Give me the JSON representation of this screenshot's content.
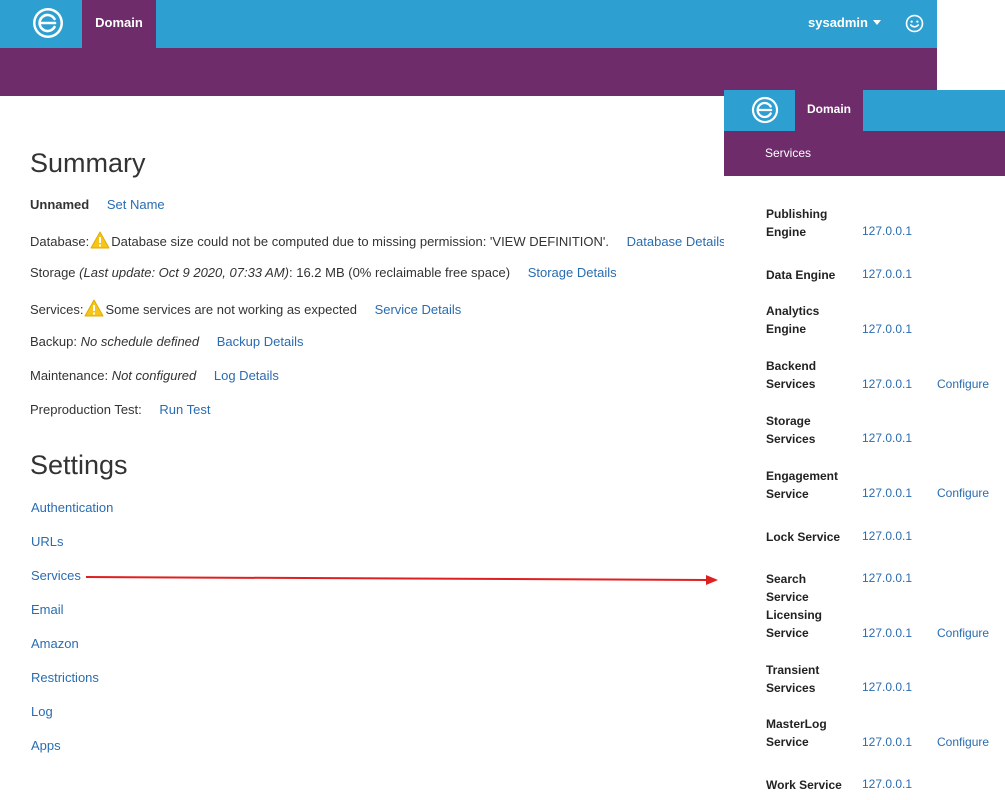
{
  "header": {
    "domain_tab": "Domain",
    "user": "sysadmin"
  },
  "summary": {
    "title": "Summary",
    "unnamed_label": "Unnamed",
    "set_name": "Set Name",
    "database_label": "Database:",
    "database_text": "Database size could not be computed due to missing permission: 'VIEW DEFINITION'.",
    "database_link": "Database Details",
    "storage_label": "Storage",
    "storage_update": "(Last update: Oct 9 2020, 07:33 AM)",
    "storage_text": ": 16.2 MB (0% reclaimable free space)",
    "storage_link": "Storage Details",
    "services_label": "Services:",
    "services_text": "Some services are not working as expected",
    "services_link": "Service Details",
    "backup_label": "Backup:",
    "backup_value": "No schedule defined",
    "backup_link": "Backup Details",
    "maintenance_label": "Maintenance:",
    "maintenance_value": "Not configured",
    "maintenance_link": "Log Details",
    "preprod_label": "Preproduction Test:",
    "preprod_link": "Run Test"
  },
  "settings": {
    "title": "Settings",
    "items": [
      "Authentication",
      "URLs",
      "Services",
      "Email",
      "Amazon",
      "Restrictions",
      "Log",
      "Apps"
    ]
  },
  "panel": {
    "domain_tab": "Domain",
    "subtitle": "Services",
    "services": [
      {
        "name": "Publishing Engine",
        "ip": "127.0.0.1",
        "configure": ""
      },
      {
        "name": "Data Engine",
        "ip": "127.0.0.1",
        "configure": ""
      },
      {
        "name": "Analytics Engine",
        "ip": "127.0.0.1",
        "configure": ""
      },
      {
        "name": "Backend Services",
        "ip": "127.0.0.1",
        "configure": "Configure"
      },
      {
        "name": "Storage Services",
        "ip": "127.0.0.1",
        "configure": ""
      },
      {
        "name": "Engagement Service",
        "ip": "127.0.0.1",
        "configure": "Configure"
      },
      {
        "name": "Lock Service",
        "ip": "127.0.0.1",
        "configure": ""
      },
      {
        "name": "Search Service",
        "ip": "127.0.0.1",
        "configure": ""
      },
      {
        "name": "Licensing Service",
        "ip": "127.0.0.1",
        "configure": "Configure"
      },
      {
        "name": "Transient Services",
        "ip": "127.0.0.1",
        "configure": ""
      },
      {
        "name": "MasterLog Service",
        "ip": "127.0.0.1",
        "configure": "Configure"
      },
      {
        "name": "Work Service",
        "ip": "127.0.0.1",
        "configure": ""
      }
    ]
  },
  "colors": {
    "topbar": "#2d9fd1",
    "purple": "#6e2c6b",
    "link": "#2a6cb0",
    "warning": "#f5c518",
    "arrow": "#e02020"
  }
}
